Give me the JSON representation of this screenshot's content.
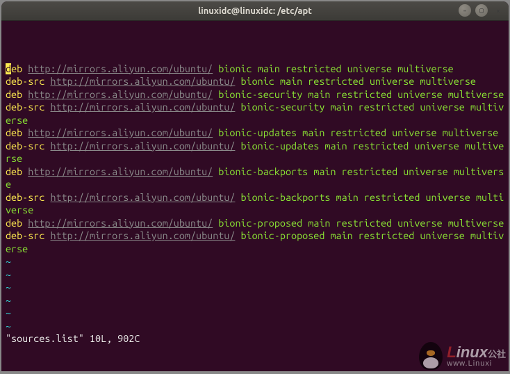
{
  "window": {
    "title": "linuxidc@linuxidc: /etc/apt"
  },
  "sources": [
    {
      "type": "deb",
      "url": "http://mirrors.aliyun.com/ubuntu/",
      "dist": "bionic",
      "components": "main restricted universe multiverse"
    },
    {
      "type": "deb-src",
      "url": "http://mirrors.aliyun.com/ubuntu/",
      "dist": "bionic",
      "components": "main restricted universe multiverse"
    },
    {
      "type": "deb",
      "url": "http://mirrors.aliyun.com/ubuntu/",
      "dist": "bionic-security",
      "components": "main restricted universe multiverse"
    },
    {
      "type": "deb-src",
      "url": "http://mirrors.aliyun.com/ubuntu/",
      "dist": "bionic-security",
      "components": "main restricted universe multiverse"
    },
    {
      "type": "deb",
      "url": "http://mirrors.aliyun.com/ubuntu/",
      "dist": "bionic-updates",
      "components": "main restricted universe multiverse"
    },
    {
      "type": "deb-src",
      "url": "http://mirrors.aliyun.com/ubuntu/",
      "dist": "bionic-updates",
      "components": "main restricted universe multiverse"
    },
    {
      "type": "deb",
      "url": "http://mirrors.aliyun.com/ubuntu/",
      "dist": "bionic-backports",
      "components": "main restricted universe multiverse"
    },
    {
      "type": "deb-src",
      "url": "http://mirrors.aliyun.com/ubuntu/",
      "dist": "bionic-backports",
      "components": "main restricted universe multiverse"
    },
    {
      "type": "deb",
      "url": "http://mirrors.aliyun.com/ubuntu/",
      "dist": "bionic-proposed",
      "components": "main restricted universe multiverse"
    },
    {
      "type": "deb-src",
      "url": "http://mirrors.aliyun.com/ubuntu/",
      "dist": "bionic-proposed",
      "components": "main restricted universe multiverse"
    }
  ],
  "tilde_rows": 6,
  "tilde_char": "~",
  "status_line": "\"sources.list\" 10L, 902C",
  "watermark": {
    "brand_pre": "L",
    "brand_rest": "inux",
    "subtitle": "www.Linuxi",
    "cn": "公社"
  }
}
